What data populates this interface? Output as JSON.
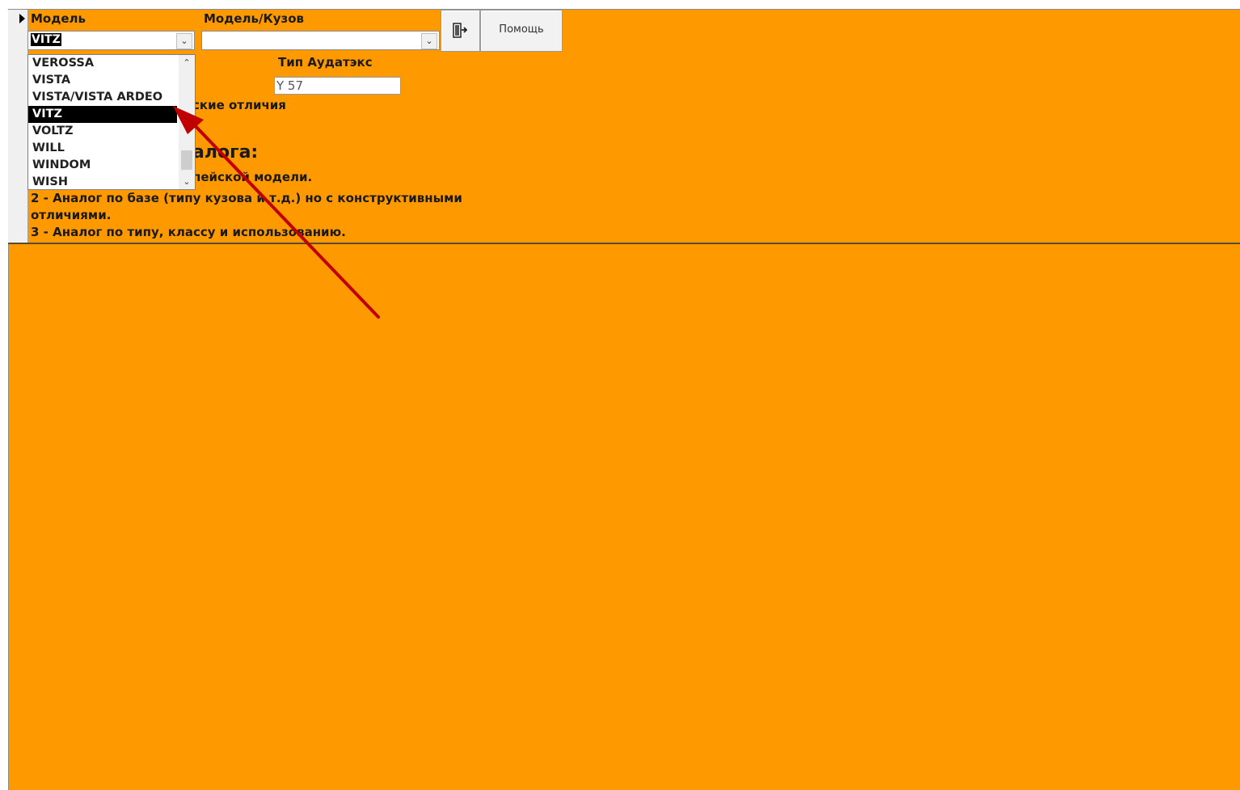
{
  "form": {
    "model_label": "Модель",
    "model_body_label": "Модель/Кузов",
    "audatex_type_label": "Тип Аудатэкс",
    "model_value": "VITZ",
    "model_body_value": "",
    "audatex_type_value": "Y 57",
    "help_button_label": "Помощь",
    "exit_icon": "exit-door-icon",
    "dropdown_items": [
      "VEROSSA",
      "VISTA",
      "VISTA/VISTA ARDEO",
      "VITZ",
      "VOLTZ",
      "WILL",
      "WINDOM",
      "WISH"
    ],
    "dropdown_selected": "VITZ",
    "partial_text_1": "ские отличия",
    "partial_heading": "алога:",
    "partial_text_2": "пейской модели.",
    "line_2a": "2 - Аналог по базе (типу кузова и т.д.) но с конструктивными",
    "line_2b": "отличиями.",
    "line_3": "3 - Аналог по типу, классу и использованию."
  },
  "colors": {
    "background": "#FF9900",
    "arrow": "#C00000",
    "selection": "#000000"
  }
}
